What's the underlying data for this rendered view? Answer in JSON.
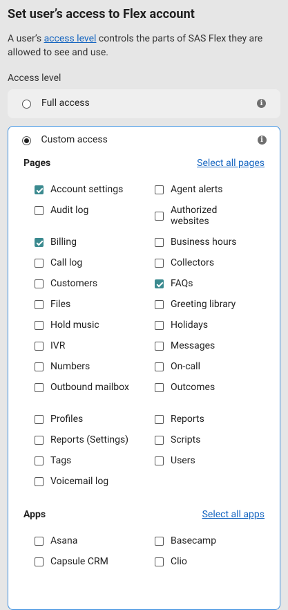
{
  "title": "Set user’s access to Flex account",
  "intro": {
    "prefix": "A user’s ",
    "link": "access level",
    "suffix": " controls the parts of SAS Flex they are allowed to see and use."
  },
  "access_label": "Access level",
  "options": {
    "full": {
      "label": "Full access",
      "selected": false,
      "info_icon": "info-icon"
    },
    "custom": {
      "label": "Custom access",
      "selected": true,
      "info_icon": "info-icon"
    }
  },
  "pages": {
    "heading": "Pages",
    "select_all": "Select all pages",
    "items": [
      {
        "label": "Account settings",
        "checked": true
      },
      {
        "label": "Agent alerts",
        "checked": false
      },
      {
        "label": "Audit log",
        "checked": false
      },
      {
        "label": "Authorized websites",
        "checked": false
      },
      {
        "label": "Billing",
        "checked": true
      },
      {
        "label": "Business hours",
        "checked": false
      },
      {
        "label": "Call log",
        "checked": false
      },
      {
        "label": "Collectors",
        "checked": false
      },
      {
        "label": "Customers",
        "checked": false
      },
      {
        "label": "FAQs",
        "checked": true
      },
      {
        "label": "Files",
        "checked": false
      },
      {
        "label": "Greeting library",
        "checked": false
      },
      {
        "label": "Hold music",
        "checked": false
      },
      {
        "label": "Holidays",
        "checked": false
      },
      {
        "label": "IVR",
        "checked": false
      },
      {
        "label": "Messages",
        "checked": false
      },
      {
        "label": "Numbers",
        "checked": false
      },
      {
        "label": "On-call",
        "checked": false
      },
      {
        "label": "Outbound mailbox",
        "checked": false
      },
      {
        "label": "Outcomes",
        "checked": false
      },
      {
        "label": "Profiles",
        "checked": false
      },
      {
        "label": "Reports",
        "checked": false
      },
      {
        "label": "Reports (Settings)",
        "checked": false
      },
      {
        "label": "Scripts",
        "checked": false
      },
      {
        "label": "Tags",
        "checked": false
      },
      {
        "label": "Users",
        "checked": false
      },
      {
        "label": "Voicemail log",
        "checked": false
      }
    ]
  },
  "apps": {
    "heading": "Apps",
    "select_all": "Select all apps",
    "items": [
      {
        "label": "Asana",
        "checked": false
      },
      {
        "label": "Basecamp",
        "checked": false
      },
      {
        "label": "Capsule CRM",
        "checked": false
      },
      {
        "label": "Clio",
        "checked": false
      }
    ]
  }
}
